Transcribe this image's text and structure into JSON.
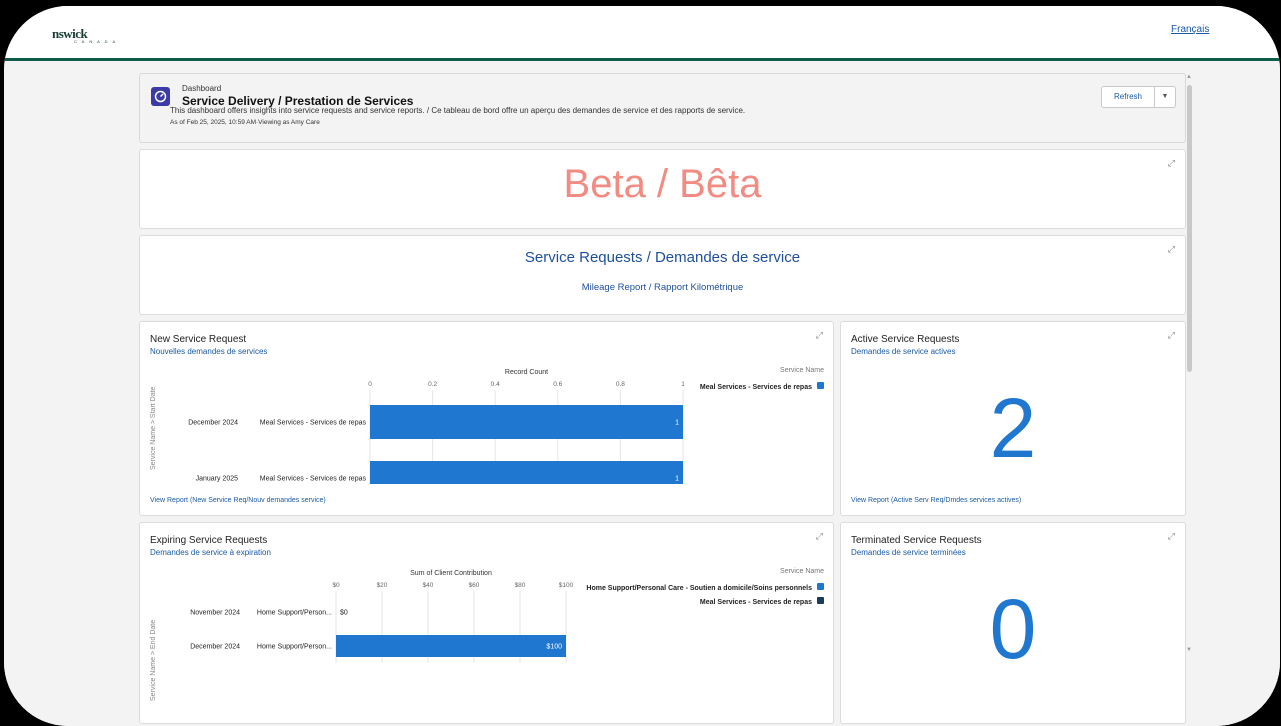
{
  "topbar": {
    "logo": "nswick",
    "logo_sub": "C A N A D A",
    "language_link": "Français"
  },
  "header": {
    "label": "Dashboard",
    "title": "Service Delivery / Prestation de Services",
    "description": "This dashboard offers insights into service requests and service reports. / Ce tableau de bord offre un aperçu des demandes de service et des rapports de service.",
    "as_of": "As of Feb 25, 2025, 10:59 AM·Viewing as Amy Care",
    "refresh_label": "Refresh",
    "menu_icon": "chevron-down-icon"
  },
  "beta": {
    "text": "Beta / Bêta"
  },
  "service_requests": {
    "title": "Service Requests / Demandes de service",
    "link": "Mileage Report / Rapport Kilométrique"
  },
  "new_service_request": {
    "title": "New Service Request",
    "subtitle": "Nouvelles demandes de services",
    "y_axis_label": "Service Name > Start Date",
    "legend_title": "Service Name",
    "view_report": "View Report (New Service Req/Nouv demandes service)"
  },
  "active_service_requests": {
    "title": "Active Service Requests",
    "subtitle": "Demandes de service actives",
    "value": "2",
    "view_report": "View Report (Active Serv Req/Dmdes services actives)"
  },
  "expiring_service_requests": {
    "title": "Expiring Service Requests",
    "subtitle": "Demandes de service à expiration",
    "y_axis_label": "Service Name > End Date",
    "legend_title": "Service Name"
  },
  "terminated_service_requests": {
    "title": "Terminated Service Requests",
    "subtitle": "Demandes de service terminées",
    "value": "0"
  },
  "colors": {
    "accent": "#1f77d0",
    "dark_series": "#1b3a5c",
    "beta": "#f28b82",
    "topbar_rule": "#0f5c4a"
  },
  "chart_data": [
    {
      "type": "bar",
      "orientation": "horizontal",
      "xlabel": "Record Count",
      "xlim": [
        0,
        1
      ],
      "xticks": [
        "0",
        "0.2",
        "0.4",
        "0.6",
        "0.8",
        "1"
      ],
      "categories": [
        {
          "date": "December 2024",
          "service": "Meal Services - Services de repas"
        },
        {
          "date": "January 2025",
          "service": "Meal Services - Services de repas"
        }
      ],
      "series": [
        {
          "name": "Meal Services - Services de repas",
          "values": [
            1,
            1
          ],
          "labels": [
            "1",
            "1"
          ]
        }
      ],
      "legend_position": "right",
      "grid": true
    },
    {
      "type": "bar",
      "orientation": "horizontal",
      "xlabel": "Sum of Client Contribution",
      "xlim": [
        0,
        100
      ],
      "xticks": [
        "$0",
        "$20",
        "$40",
        "$60",
        "$80",
        "$100"
      ],
      "categories": [
        {
          "date": "November 2024",
          "service": "Home Support/Person..."
        },
        {
          "date": "December 2024",
          "service": "Home Support/Person..."
        }
      ],
      "series": [
        {
          "name": "Home Support/Personal Care - Soutien a domicile/Soins personnels",
          "values": [
            0,
            100
          ],
          "labels": [
            "$0",
            "$100"
          ]
        },
        {
          "name": "Meal Services - Services de repas",
          "values": [
            0,
            0
          ]
        }
      ],
      "legend_position": "right",
      "grid": true
    }
  ]
}
